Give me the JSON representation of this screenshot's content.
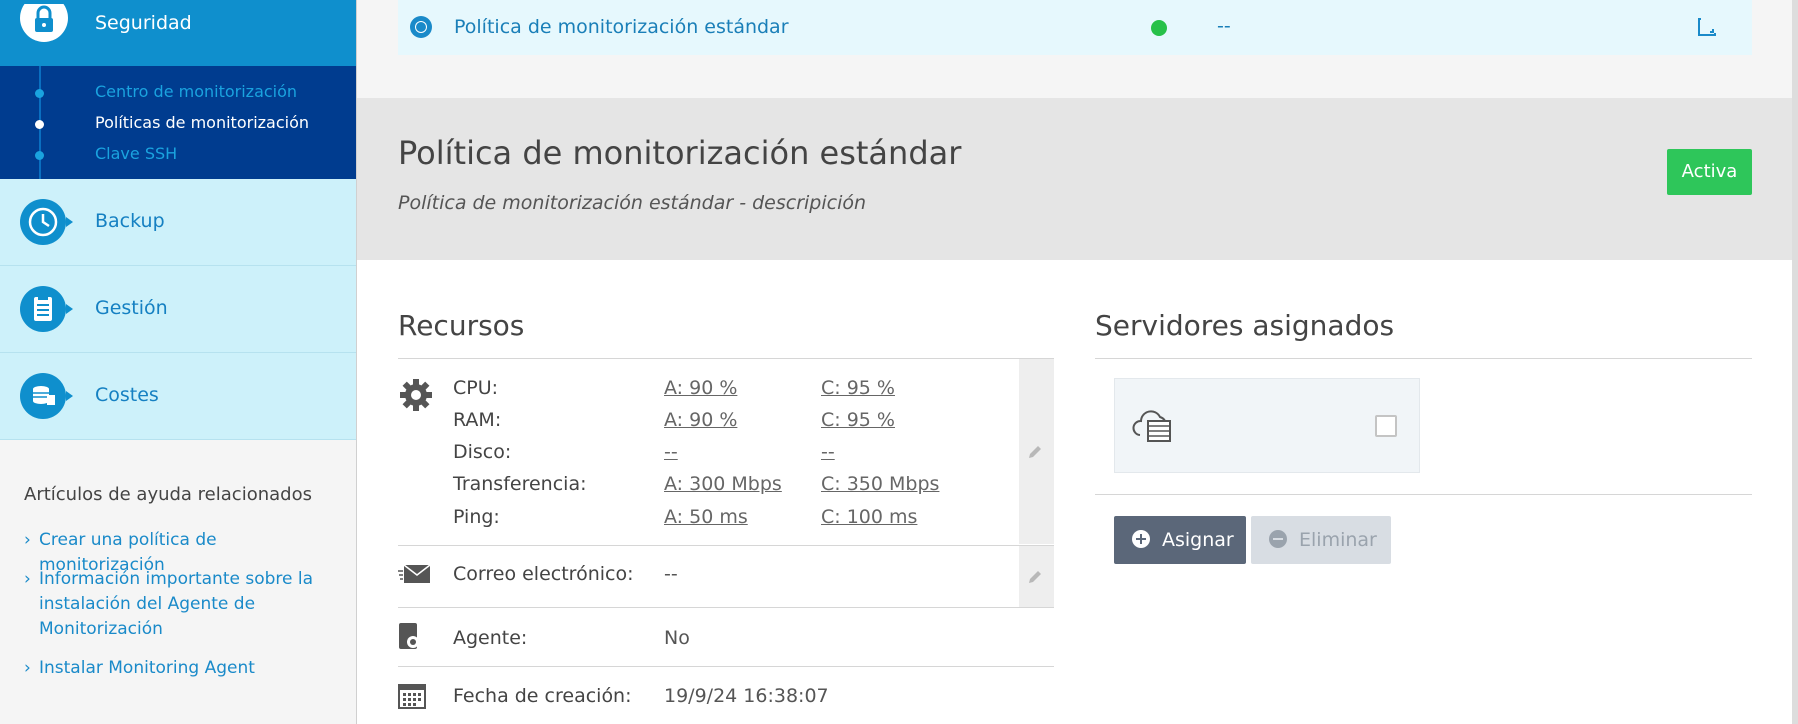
{
  "sidebar": {
    "security": {
      "label": "Seguridad",
      "icon": "lock-icon"
    },
    "security_sub": [
      {
        "label": "Centro de monitorización",
        "active": false
      },
      {
        "label": "Políticas de monitorización",
        "active": true
      },
      {
        "label": "Clave SSH",
        "active": false
      }
    ],
    "items": [
      {
        "label": "Backup",
        "icon": "history-icon"
      },
      {
        "label": "Gestión",
        "icon": "clipboard-icon"
      },
      {
        "label": "Costes",
        "icon": "coins-icon"
      }
    ],
    "help": {
      "title": "Artículos de ayuda relacionados",
      "links": [
        "Crear una política de monitorización",
        "Información importante sobre la instalación del Agente de Monitorización",
        "Instalar Monitoring Agent"
      ]
    }
  },
  "policy_row": {
    "name": "Política de monitorización estándar",
    "status_color": "#27c149",
    "value": "--"
  },
  "header": {
    "title": "Política de monitorización estándar",
    "description": "Política de monitorización estándar - descripición",
    "status_button": "Activa"
  },
  "resources": {
    "title": "Recursos",
    "rows": [
      {
        "label": "CPU:",
        "warning": "A: 90 %",
        "critical": "C: 95 %"
      },
      {
        "label": "RAM:",
        "warning": "A: 90 %",
        "critical": "C: 95 %"
      },
      {
        "label": "Disco:",
        "warning": "--",
        "critical": "--"
      },
      {
        "label": "Transferencia:",
        "warning": "A: 300 Mbps",
        "critical": "C: 350 Mbps"
      },
      {
        "label": "Ping:",
        "warning": "A: 50 ms",
        "critical": "C: 100 ms"
      }
    ],
    "email": {
      "label": "Correo electrónico:",
      "value": "--"
    },
    "agent": {
      "label": "Agente:",
      "value": "No"
    },
    "created": {
      "label": "Fecha de creación:",
      "value": "19/9/24 16:38:07"
    }
  },
  "servers": {
    "title": "Servidores asignados",
    "assign_button": "Asignar",
    "remove_button": "Eliminar"
  },
  "colors": {
    "accent": "#1a8ac9",
    "sidebar_active": "#0f8fcd",
    "subnav_bg": "#003c8f",
    "nav_bg": "#cdf1fa",
    "success": "#2ec65a"
  }
}
